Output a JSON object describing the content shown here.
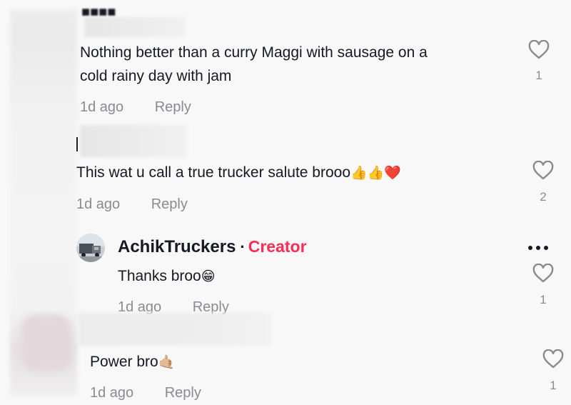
{
  "comments": [
    {
      "text": "Nothing better than a curry Maggi with sausage on a",
      "text_line2": "cold rainy day with jam",
      "time": "1d ago",
      "reply_label": "Reply",
      "likes": "1"
    },
    {
      "text": "This wat u call a true trucker salute brooo",
      "emoji": "👍👍❤️",
      "time": "1d ago",
      "reply_label": "Reply",
      "likes": "2"
    }
  ],
  "creator_reply": {
    "username": "AchikTruckers",
    "separator": "·",
    "badge": "Creator",
    "text": "Thanks broo",
    "emoji": "😁",
    "time": "1d ago",
    "reply_label": "Reply",
    "likes": "1"
  },
  "last_comment": {
    "text": "Power bro",
    "emoji": "🤙🏼",
    "time": "1d ago",
    "reply_label": "Reply",
    "likes": "1"
  },
  "colors": {
    "accent_creator": "#fe2c55",
    "meta_gray": "#8a8b91",
    "text": "#161823"
  },
  "icons": {
    "like": "heart-outline-icon",
    "more": "more-dots-icon"
  }
}
